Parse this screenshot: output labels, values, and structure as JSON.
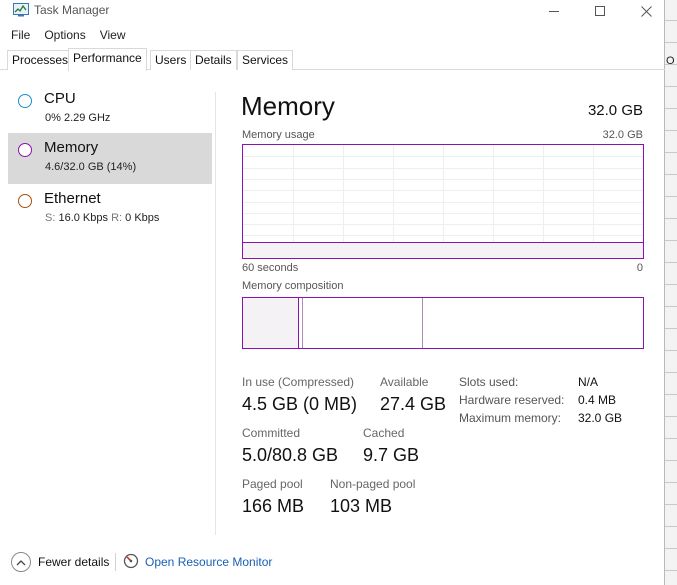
{
  "window": {
    "title": "Task Manager"
  },
  "menu": [
    "File",
    "Options",
    "View"
  ],
  "tabs": [
    {
      "label": "Processes",
      "active": false
    },
    {
      "label": "Performance",
      "active": true
    },
    {
      "label": "Users",
      "active": false
    },
    {
      "label": "Details",
      "active": false
    },
    {
      "label": "Services",
      "active": false
    }
  ],
  "sidebar": {
    "items": [
      {
        "title": "CPU",
        "sub": "0%  2.29 GHz",
        "color": "#1c8fc7",
        "selected": false
      },
      {
        "title": "Memory",
        "sub": "4.6/32.0 GB (14%)",
        "color": "#8b12ae",
        "selected": true
      },
      {
        "title": "Ethernet",
        "sub_s_label": "S:",
        "sub_s_value": "16.0 Kbps",
        "sub_r_label": "R:",
        "sub_r_value": "0 Kbps",
        "color": "#a7520d",
        "selected": false
      }
    ]
  },
  "main": {
    "title": "Memory",
    "total": "32.0 GB",
    "usage_chart": {
      "label": "Memory usage",
      "max_label": "32.0 GB",
      "time_label": "60 seconds",
      "end_label": "0",
      "used_fraction": 0.14
    },
    "composition": {
      "label": "Memory composition",
      "in_use_fraction": 0.14,
      "modified_fraction": 0.01,
      "standby_fraction": 0.3
    },
    "stats": {
      "in_use_label": "In use (Compressed)",
      "in_use_value": "4.5 GB (0 MB)",
      "available_label": "Available",
      "available_value": "27.4 GB",
      "committed_label": "Committed",
      "committed_value": "5.0/80.8 GB",
      "cached_label": "Cached",
      "cached_value": "9.7 GB",
      "paged_label": "Paged pool",
      "paged_value": "166 MB",
      "nonpaged_label": "Non-paged pool",
      "nonpaged_value": "103 MB"
    },
    "details": [
      {
        "key": "Slots used:",
        "value": "N/A"
      },
      {
        "key": "Hardware reserved:",
        "value": "0.4 MB"
      },
      {
        "key": "Maximum memory:",
        "value": "32.0 GB"
      }
    ]
  },
  "footer": {
    "fewer_details": "Fewer details",
    "open_resource_monitor": "Open Resource Monitor"
  },
  "colors": {
    "memory_accent": "#8b12ae",
    "link": "#1a5fb4"
  },
  "background_glyph": "O"
}
